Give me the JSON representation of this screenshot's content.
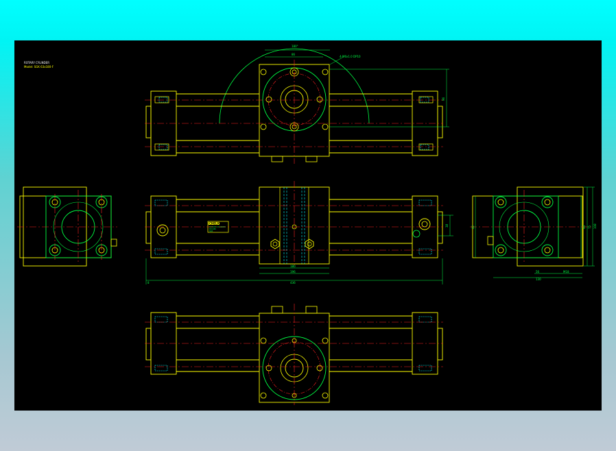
{
  "title_block": {
    "line1": "ROTARY CYLINDER",
    "line2": "Model: SGK 63x180-F"
  },
  "nameplate": {
    "brand": "CHELIC",
    "line1": "ROTARY CYLINDER",
    "line2": "63x180",
    "line3": "SGK"
  },
  "dims": {
    "top_arc": "180°",
    "top_block": "86",
    "top_callout": "4-M6x1.0 DP10",
    "top_right": "96",
    "mid_inner": "180",
    "mid_bottom1": "196",
    "mid_bottom2": "436",
    "mid_right": "38",
    "right_h1": "75",
    "right_h2": "94",
    "right_h3": "108",
    "right_v1": "42",
    "right_b1": "56",
    "right_b2": "M18",
    "right_b3": "130",
    "left_a": "8",
    "right_small": "13"
  },
  "colors": {
    "line": "#ffff00",
    "center": "#ff2020",
    "green": "#00ff44",
    "cyan": "#00ffff",
    "white": "#ffffff",
    "canvas": "#000000"
  }
}
